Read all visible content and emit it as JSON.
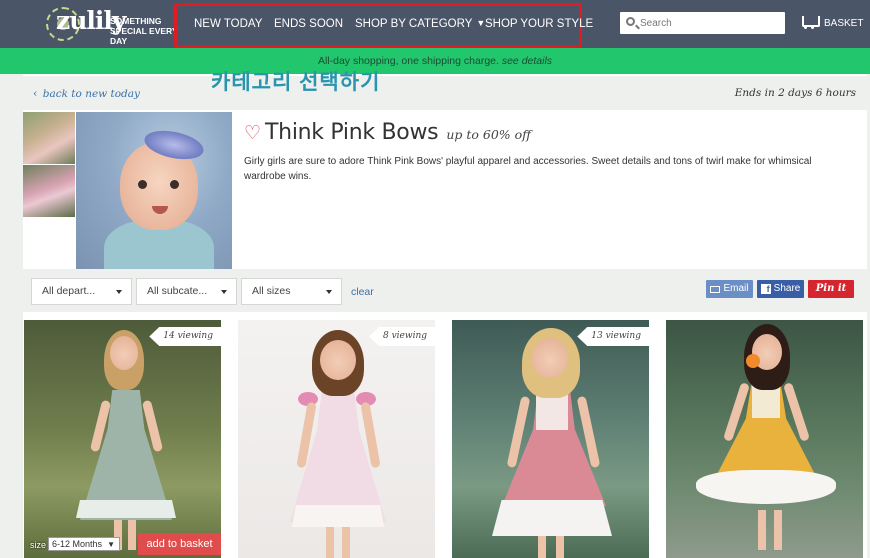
{
  "header": {
    "logo_word": "zulily",
    "logo_tagline": "SOMETHING SPECIAL EVERY DAY",
    "nav": [
      {
        "label": "NEW TODAY"
      },
      {
        "label": "ENDS SOON"
      },
      {
        "label": "SHOP BY CATEGORY"
      },
      {
        "label": "SHOP YOUR STYLE"
      }
    ],
    "search_placeholder": "Search",
    "basket_label": "BASKET"
  },
  "promo": {
    "text": "All-day shopping, one shipping charge.",
    "link": "see details"
  },
  "annotation": "카테고리 선택하기",
  "breadcrumb": {
    "back": "back to new today",
    "ends": "Ends in 2 days 6 hours"
  },
  "event": {
    "title": "Think Pink Bows",
    "subtitle": "up to 60% off",
    "description": "Girly girls are sure to adore Think Pink Bows' playful apparel and accessories. Sweet details and tons of twirl make for whimsical wardrobe wins."
  },
  "filters": {
    "department": "All depart...",
    "subcategory": "All subcate...",
    "sizes": "All sizes",
    "clear": "clear"
  },
  "share": {
    "email": "Email",
    "facebook": "Share",
    "pinterest": "Pin it"
  },
  "products": [
    {
      "viewing": "14 viewing",
      "size_label": "size",
      "size_value": "6-12 Months",
      "add_label": "add to basket"
    },
    {
      "viewing": "8 viewing"
    },
    {
      "viewing": "13 viewing"
    },
    {}
  ],
  "colors": {
    "header_bg": "#4b5568",
    "promo_bg": "#22c76d",
    "highlight_box": "#e01b24",
    "link": "#3b6fa9",
    "add_button": "#e04b4b",
    "pinterest": "#d5262f",
    "facebook": "#3a5ea6"
  }
}
